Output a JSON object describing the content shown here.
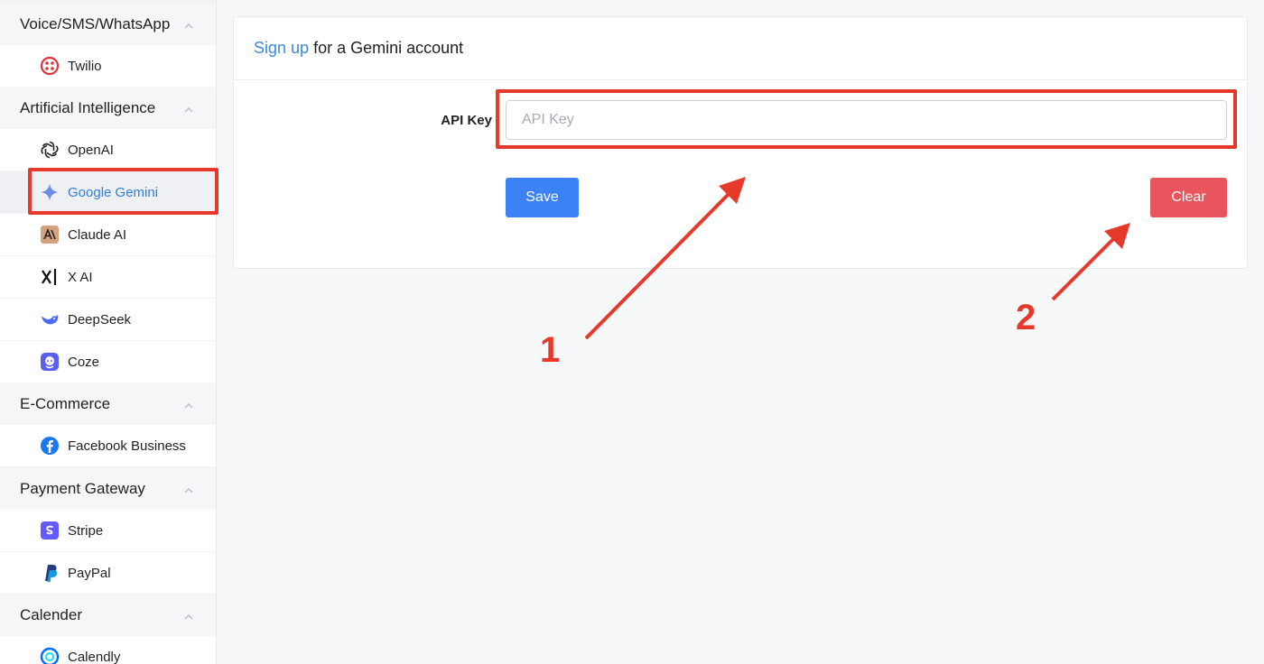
{
  "sidebar": {
    "groups": [
      {
        "title": "Voice/SMS/WhatsApp",
        "items": [
          {
            "label": "Twilio",
            "icon": "twilio-icon"
          }
        ]
      },
      {
        "title": "Artificial Intelligence",
        "items": [
          {
            "label": "OpenAI",
            "icon": "openai-icon"
          },
          {
            "label": "Google Gemini",
            "icon": "gemini-icon",
            "active": true
          },
          {
            "label": "Claude AI",
            "icon": "claude-icon"
          },
          {
            "label": "X AI",
            "icon": "xai-icon"
          },
          {
            "label": "DeepSeek",
            "icon": "deepseek-icon"
          },
          {
            "label": "Coze",
            "icon": "coze-icon"
          }
        ]
      },
      {
        "title": "E-Commerce",
        "items": [
          {
            "label": "Facebook Business",
            "icon": "facebook-icon"
          }
        ]
      },
      {
        "title": "Payment Gateway",
        "items": [
          {
            "label": "Stripe",
            "icon": "stripe-icon"
          },
          {
            "label": "PayPal",
            "icon": "paypal-icon"
          }
        ]
      },
      {
        "title": "Calender",
        "items": [
          {
            "label": "Calendly",
            "icon": "calendly-icon"
          }
        ]
      }
    ]
  },
  "main": {
    "signup_link": "Sign up",
    "header_rest": "for a Gemini account",
    "api_key_label": "API Key",
    "api_key_placeholder": "API Key",
    "api_key_value": "",
    "save_label": "Save",
    "clear_label": "Clear"
  },
  "annotations": {
    "step1": "1",
    "step2": "2",
    "color": "#e5392c"
  },
  "colors": {
    "accent_blue": "#3b82f6",
    "link_blue": "#3b8ad8",
    "danger_red": "#e8555c",
    "annotation_red": "#e5392c"
  }
}
